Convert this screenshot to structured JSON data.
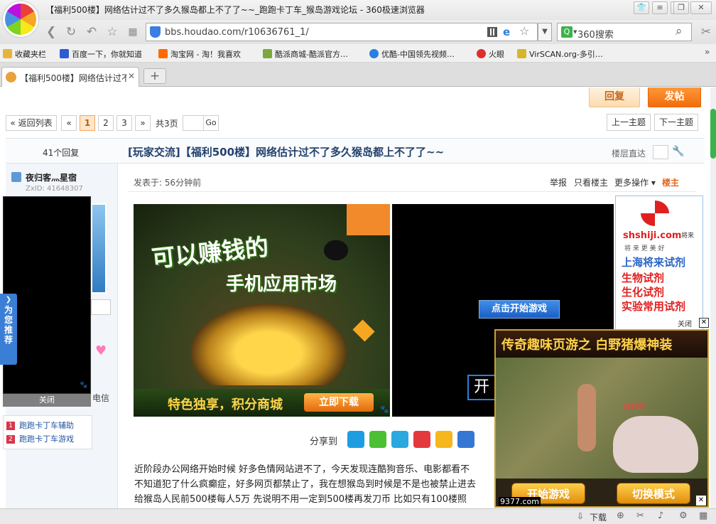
{
  "browser": {
    "title": "【福利500楼】网络估计过不了多久猴岛都上不了了~~_跑跑卡丁车_猴岛游戏论坛 - 360极速浏览器",
    "url": "bbs.houdao.com/r10636761_1/",
    "search_placeholder": "360搜索",
    "bookmarks": [
      {
        "label": "收藏夹栏",
        "icon": "folder-icon",
        "color": "#e8b33a"
      },
      {
        "label": "百度一下，你就知道",
        "icon": "baidu-icon",
        "color": "#2d5bd1"
      },
      {
        "label": "淘宝网 - 淘！我喜欢",
        "icon": "taobao-icon",
        "color": "#ff6a00"
      },
      {
        "label": "酷派商城-酷派官方…",
        "icon": "coolpad-icon",
        "color": "#7aa83a"
      },
      {
        "label": "优酷-中国领先视频…",
        "icon": "youku-icon",
        "color": "#2b7de0"
      },
      {
        "label": "火眼",
        "icon": "fire-eye-icon",
        "color": "#e02d2d"
      },
      {
        "label": "VirSCAN.org-多引…",
        "icon": "virscan-icon",
        "color": "#d7b72a"
      }
    ],
    "tab": {
      "label": "【福利500楼】网络估计过不"
    },
    "status": {
      "download": "下载"
    }
  },
  "forum": {
    "reply_button": "回复",
    "post_button": "发帖",
    "back_to_list": "« 返回列表",
    "prev_page": "«",
    "pages": [
      "1",
      "2",
      "3"
    ],
    "current_page": "1",
    "next_page": "»",
    "total_pages": "共3页",
    "go_button": "Go",
    "prev_topic": "上一主题",
    "next_topic": "下一主题",
    "reply_count": "41个回复",
    "thread_title": "[玩家交流]【福利500楼】网络估计过不了多久猴岛都上不了了~~",
    "floor_jump": "楼层直达",
    "author": {
      "name": "夜归客灬星宿",
      "zxid": "ZxID: 41648307",
      "trust": "电信"
    },
    "posted_at": "发表于: 56分钟前",
    "actions": [
      "举报",
      "只看楼主",
      "更多操作 ▾"
    ],
    "role": "楼主",
    "share_label": "分享到",
    "body_lines": [
      "近阶段办公网络开始时候 好多色情网站进不了，今天发现连酷狗音乐、电影都看不",
      "不知道犯了什么疯癫症，好多网页都禁止了，我在想猴岛到时候是不是也被禁止进去",
      "给猴岛人民前500楼每人5万 先说明不用一定到500楼再发刀币 比如只有100楼照"
    ]
  },
  "ads": {
    "ad1": {
      "line1": "可以赚钱的",
      "line2": "手机应用市场",
      "footer": "特色独享，积分商城",
      "cta": "立即下载"
    },
    "ad2": {
      "cta": "点击开始游戏",
      "partial": "开"
    },
    "ad3": {
      "brand": "shshiji.com",
      "brand_cn": "将来",
      "tagline": "将 来 更 美 好",
      "lines": [
        "上海将来试剂",
        "生物试剂",
        "生化试剂",
        "实验常用试剂"
      ]
    },
    "ad4": {
      "close": "关闭",
      "headline": "传奇趣味页游之 白野猪爆神装",
      "label": "白野猪",
      "start": "开始游戏",
      "switch": "切换模式",
      "domain": "9377.com"
    },
    "left_float": {
      "close": "关闭",
      "recommend": "为您推荐"
    },
    "recommend_list": [
      "跑跑卡丁车辅助",
      "跑跑卡丁车游戏"
    ]
  }
}
